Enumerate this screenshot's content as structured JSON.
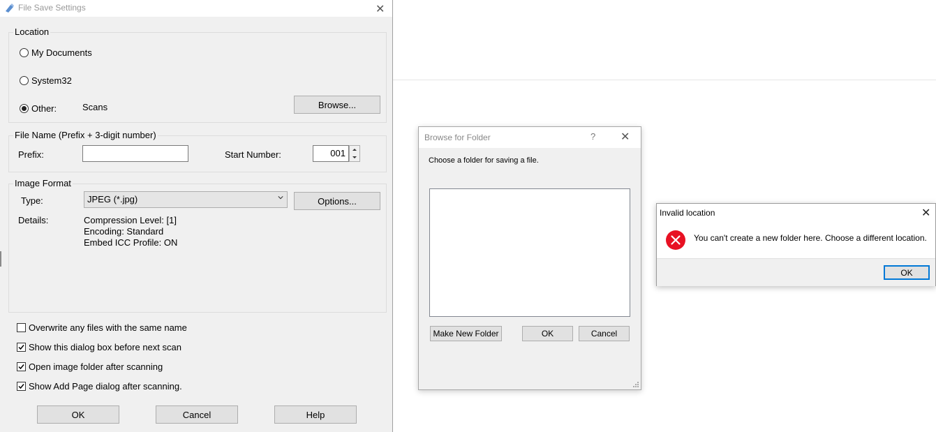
{
  "file_save_settings": {
    "title": "File Save Settings",
    "close_glyph": "✕",
    "location": {
      "group_label": "Location",
      "options": [
        {
          "label": "My Documents",
          "selected": false
        },
        {
          "label": "System32",
          "selected": false
        },
        {
          "label": "Other:",
          "selected": true
        }
      ],
      "other_value": "Scans",
      "browse_label": "Browse..."
    },
    "file_name": {
      "group_label": "File Name (Prefix + 3-digit number)",
      "prefix_label": "Prefix:",
      "prefix_value": "",
      "start_number_label": "Start Number:",
      "start_number_value": "001"
    },
    "image_format": {
      "group_label": "Image Format",
      "type_label": "Type:",
      "type_value": "JPEG (*.jpg)",
      "options_label": "Options...",
      "details_label": "Details:",
      "details": [
        "Compression Level: [1]",
        "Encoding: Standard",
        "Embed ICC Profile: ON"
      ]
    },
    "checkboxes": [
      {
        "label": "Overwrite any files with the same name",
        "checked": false
      },
      {
        "label": "Show this dialog box before next scan",
        "checked": true
      },
      {
        "label": "Open image folder after scanning",
        "checked": true
      },
      {
        "label": "Show Add Page dialog after scanning.",
        "checked": true
      }
    ],
    "buttons": {
      "ok": "OK",
      "cancel": "Cancel",
      "help": "Help"
    }
  },
  "browse_for_folder": {
    "title": "Browse for Folder",
    "help_glyph": "?",
    "close_glyph": "✕",
    "instruction": "Choose a folder for saving a file.",
    "buttons": {
      "make_new_folder": "Make New Folder",
      "ok": "OK",
      "cancel": "Cancel"
    }
  },
  "invalid_location": {
    "title": "Invalid location",
    "close_glyph": "✕",
    "message": "You can't create a new folder here. Choose a different location.",
    "ok": "OK",
    "icon": "error-icon",
    "icon_color": "#e81123"
  },
  "colors": {
    "accent": "#0078d7",
    "dialog_bg": "#f0f0f0"
  }
}
